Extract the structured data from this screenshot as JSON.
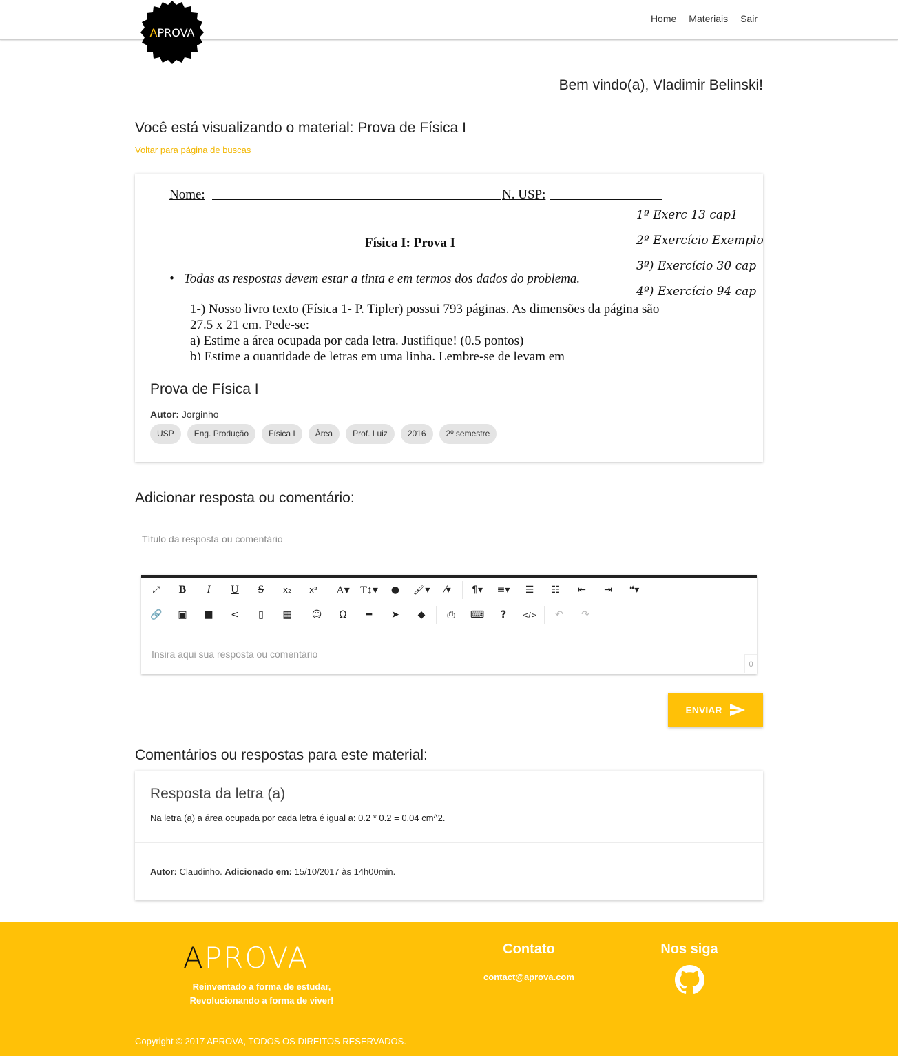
{
  "brand": {
    "name": "APROVA",
    "first_letter": "A",
    "rest": "PROVA",
    "accent": "#ffc107"
  },
  "nav": {
    "items": [
      {
        "label": "Home"
      },
      {
        "label": "Materiais"
      },
      {
        "label": "Sair"
      }
    ]
  },
  "welcome": "Bem vindo(a), Vladimir Belinski!",
  "viewing": "Você está visualizando o material: Prova de Física I",
  "back_link": "Voltar para página de buscas",
  "material": {
    "preview": {
      "name_label": "Nome:",
      "usp_label": "N. USP:",
      "handwritten": [
        "1º Exerc 13 cap1",
        "2º Exercício Exemplo",
        "3º) Exercício 30 cap",
        "4º) Exercício 94 cap"
      ],
      "title": "Física I: Prova I",
      "bullet": "Todas as respostas devem estar a tinta e em termos dos dados do problema.",
      "paragraph": "1-) Nosso livro texto (Física 1- P. Tipler) possui 793 páginas. As dimensões da página são 27.5 x 21 cm. Pede-se:",
      "item_a": "a) Estime a área ocupada por cada letra. Justifique! (0.5 pontos)",
      "item_b": "b) Estime a quantidade de letras em uma linha. Lembre-se de levam em"
    },
    "title": "Prova de Física I",
    "author_label": "Autor:",
    "author": "Jorginho",
    "tags": [
      "USP",
      "Eng. Produção",
      "Física I",
      "Área",
      "Prof. Luiz",
      "2016",
      "2º semestre"
    ]
  },
  "add_form": {
    "heading": "Adicionar resposta ou comentário:",
    "title_placeholder": "Título da resposta ou comentário",
    "body_placeholder": "Insira aqui sua resposta ou comentário",
    "char_count": "0",
    "send_label": "ENVIAR"
  },
  "comments": {
    "heading": "Comentários ou respostas para este material:",
    "items": [
      {
        "title": "Resposta da letra (a)",
        "body": "Na letra (a) a área ocupada por cada letra é igual a: 0.2 * 0.2 = 0.04 cm^2.",
        "author_label": "Autor:",
        "author": "Claudinho.",
        "added_label": "Adicionado em:",
        "added": "15/10/2017 às 14h00min."
      }
    ]
  },
  "footer": {
    "tagline_1": "Reinventado a forma de estudar,",
    "tagline_2": "Revolucionando a forma de viver!",
    "contact_title": "Contato",
    "contact_email": "contact@aprova.com",
    "follow_title": "Nos siga",
    "copyright": "Copyright © 2017 APROVA, TODOS OS DIREITOS RESERVADOS."
  }
}
